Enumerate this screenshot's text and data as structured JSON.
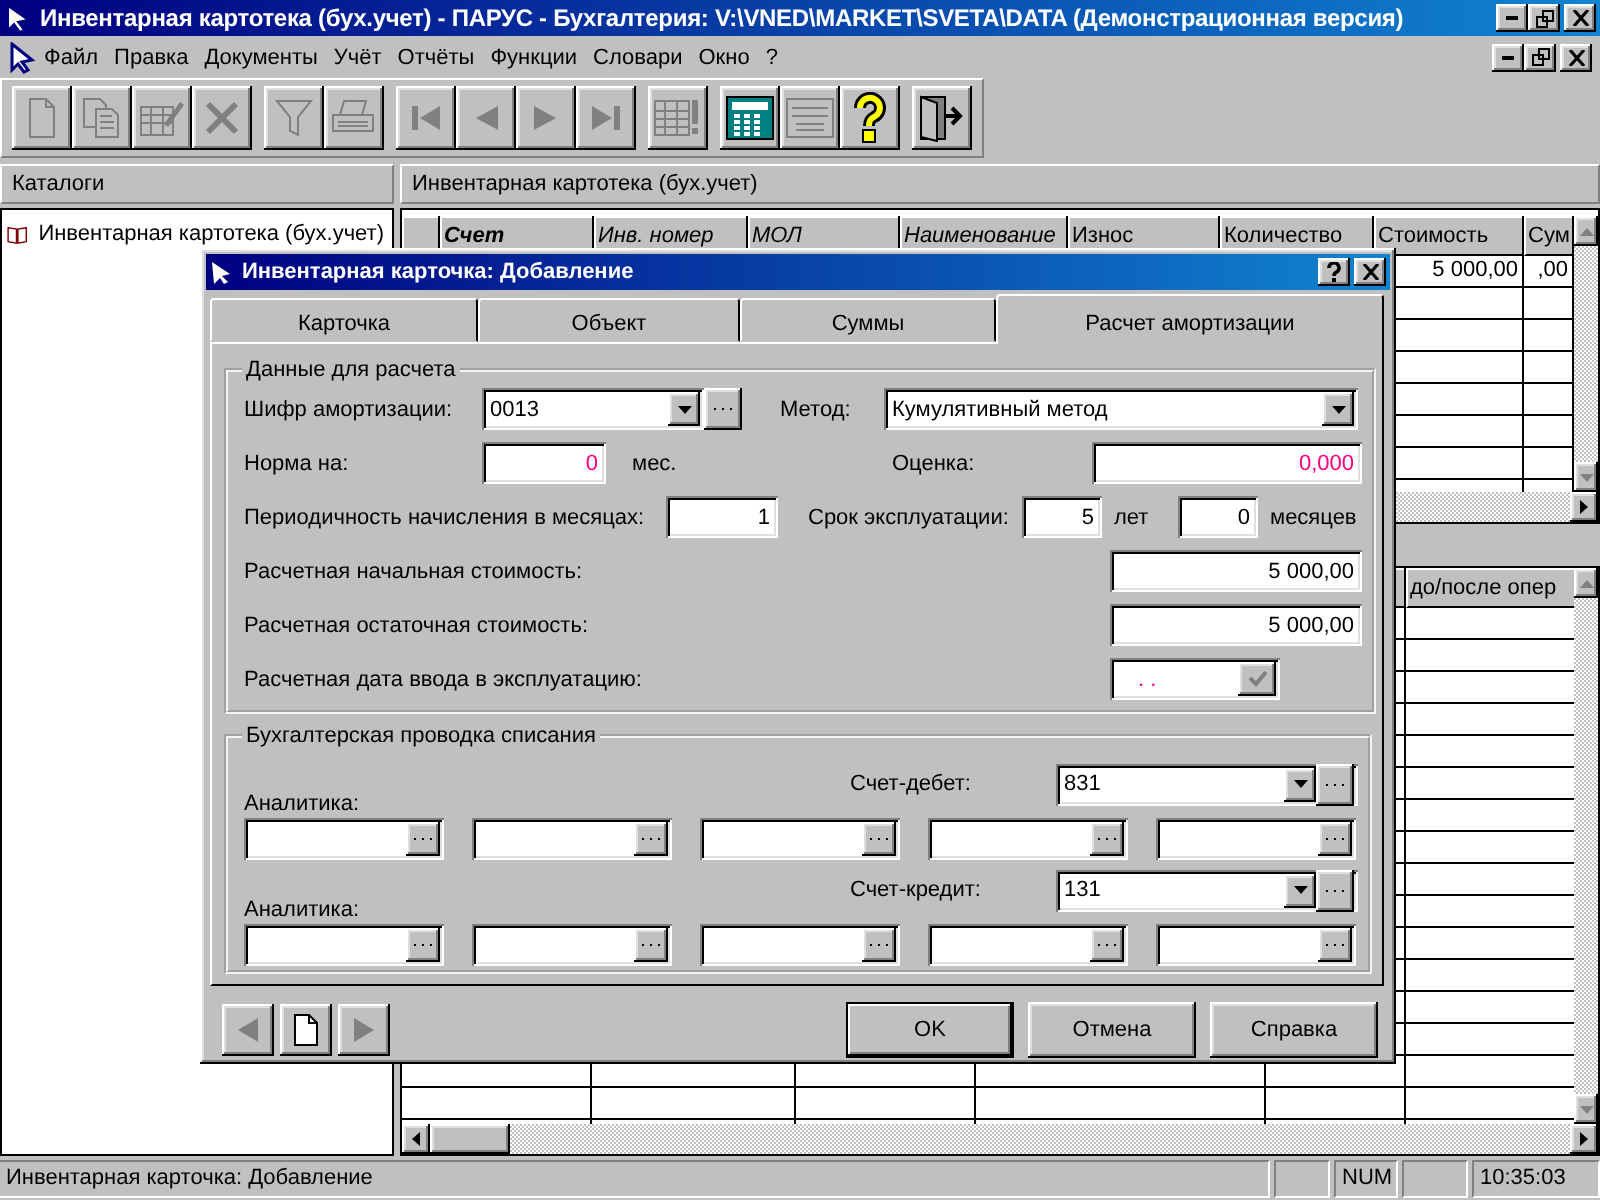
{
  "window": {
    "title": "Инвентарная картотека (бух.учет) - ПАРУС - Бухгалтерия: V:\\VNED\\MARKET\\SVETA\\DATA (Демонстрационная версия)"
  },
  "menu": [
    "Файл",
    "Правка",
    "Документы",
    "Учёт",
    "Отчёты",
    "Функции",
    "Словари",
    "Окно",
    "?"
  ],
  "toolbar": [
    {
      "kind": "new",
      "disabled": true
    },
    {
      "kind": "copy",
      "disabled": true
    },
    {
      "kind": "edit",
      "disabled": true
    },
    {
      "kind": "delete",
      "disabled": true
    },
    {
      "kind": "filter",
      "disabled": true
    },
    {
      "kind": "print",
      "disabled": true
    },
    {
      "kind": "first",
      "disabled": true
    },
    {
      "kind": "prev",
      "disabled": true
    },
    {
      "kind": "next",
      "disabled": true
    },
    {
      "kind": "last",
      "disabled": true
    },
    {
      "kind": "table",
      "disabled": true
    },
    {
      "kind": "calculator",
      "disabled": false
    },
    {
      "kind": "emblem",
      "disabled": true
    },
    {
      "kind": "help",
      "disabled": false
    },
    {
      "kind": "exit",
      "disabled": false
    }
  ],
  "catalogs": {
    "title": "Каталоги",
    "items": [
      {
        "label": "Инвентарная картотека (бух.учет)"
      }
    ]
  },
  "card_file": {
    "title": "Инвентарная картотека (бух.учет)",
    "columns": [
      {
        "label": "Счет",
        "kind": "primary"
      },
      {
        "label": "Инв. номер",
        "kind": "indexed"
      },
      {
        "label": "МОЛ",
        "kind": "indexed"
      },
      {
        "label": "Наименование",
        "kind": "indexed"
      },
      {
        "label": "Износ",
        "kind": "plain"
      },
      {
        "label": "Количество",
        "kind": "plain"
      },
      {
        "label": "Стоимость",
        "kind": "plain"
      },
      {
        "label": "Сум",
        "kind": "plain"
      }
    ],
    "rows": [
      {
        "cells": [
          "",
          "",
          "",
          "",
          "",
          "",
          "5 000,00",
          ",00"
        ]
      }
    ]
  },
  "lower_grid": {
    "columns": [
      "до/после опер"
    ]
  },
  "dialog": {
    "title": "Инвентарная карточка: Добавление",
    "tabs": [
      {
        "label": "Карточка",
        "selected": false
      },
      {
        "label": "Объект",
        "selected": false
      },
      {
        "label": "Суммы",
        "selected": false
      },
      {
        "label": "Расчет амортизации",
        "selected": true
      }
    ],
    "calc": {
      "title": "Данные для расчета",
      "depreciation_code": {
        "label": "Шифр амортизации:",
        "value": "0013"
      },
      "method": {
        "label": "Метод:",
        "value": "Кумулятивный метод"
      },
      "norm": {
        "label": "Норма на:",
        "value": "0",
        "unit": "мес.",
        "computed": true
      },
      "estimate": {
        "label": "Оценка:",
        "value": "0,000",
        "computed": true
      },
      "period": {
        "label": "Периодичность начисления в месяцах:",
        "value": "1"
      },
      "service_life": {
        "label": "Срок эксплуатации:",
        "years": "5",
        "years_unit": "лет",
        "months": "0",
        "months_unit": "месяцев"
      },
      "initial_cost": {
        "label": "Расчетная начальная стоимость:",
        "value": "5 000,00"
      },
      "residual_cost": {
        "label": "Расчетная остаточная стоимость:",
        "value": "5 000,00"
      },
      "start_date": {
        "label": "Расчетная дата ввода в эксплуатацию:",
        "value": ". .",
        "computed": true
      }
    },
    "posting": {
      "title": "Бухгалтерская проводка списания",
      "accounts": [
        {
          "label": "Счет-дебет:",
          "value": "831",
          "analytics_label": "Аналитика:",
          "analytics": [
            {
              "kind": "lookup"
            },
            {
              "kind": "lookup"
            },
            {
              "kind": "lookup"
            },
            {
              "kind": "lookup"
            },
            {
              "kind": "lookup"
            }
          ]
        },
        {
          "label": "Счет-кредит:",
          "value": "131",
          "analytics_label": "Аналитика:",
          "analytics": [
            {
              "kind": "lookup"
            },
            {
              "kind": "lookup"
            },
            {
              "kind": "lookup"
            },
            {
              "kind": "lookup"
            },
            {
              "kind": "lookup"
            }
          ]
        }
      ]
    },
    "nav": [
      {
        "kind": "prev",
        "disabled": true
      },
      {
        "kind": "new",
        "disabled": false
      },
      {
        "kind": "next",
        "disabled": true
      }
    ],
    "buttons": [
      {
        "label": "OK",
        "default": true
      },
      {
        "label": "Отмена",
        "default": false
      },
      {
        "label": "Справка",
        "default": false
      }
    ]
  },
  "status_bar": {
    "text": "Инвентарная карточка: Добавление",
    "panels": [
      {
        "kind": "blank"
      },
      {
        "kind": "text",
        "text": "NUM"
      },
      {
        "kind": "blank"
      },
      {
        "kind": "text",
        "text": "10:35:03"
      }
    ]
  }
}
